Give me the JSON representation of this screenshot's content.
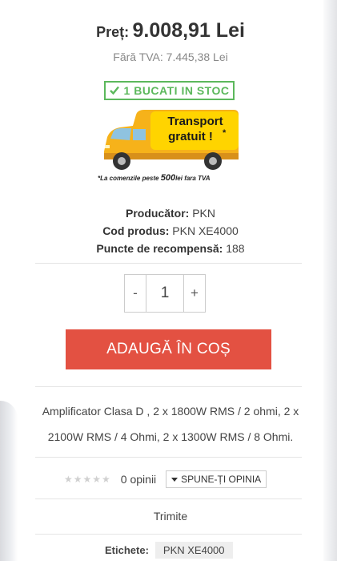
{
  "price": {
    "label": "Preț:",
    "value": "9.008,91 Lei",
    "no_vat": "Fără TVA: 7.445,38 Lei"
  },
  "stock": {
    "text": "1 BUCATI IN STOC",
    "icon": "check-icon",
    "color": "#5cb85c"
  },
  "promo": {
    "banner_line1": "Transport",
    "banner_line2": "gratuit !",
    "banner_asterisk": "*",
    "note_prefix": "*La comenzile peste ",
    "note_amount": "500",
    "note_unit": "lei",
    "note_suffix": " fara TVA"
  },
  "specs": {
    "producer_label": "Producător:",
    "producer_value": "PKN",
    "code_label": "Cod produs:",
    "code_value": "PKN XE4000",
    "points_label": "Puncte de recompensă:",
    "points_value": "188"
  },
  "quantity": {
    "minus": "-",
    "value": "1",
    "plus": "+"
  },
  "cart": {
    "button_label": "ADAUGĂ ÎN COȘ",
    "color": "#e35142"
  },
  "description": "Amplificator Clasa D , 2 x 1800W RMS / 2 ohmi, 2 x 2100W RMS / 4 Ohmi, 2 x 1300W RMS / 8 Ohmi.",
  "reviews": {
    "stars": "★★★★★",
    "rating": 0,
    "count_text": "0 opinii",
    "write_label": "SPUNE-ȚI OPINIA",
    "write_icon": "caret-down-icon"
  },
  "share": {
    "label": "Trimite"
  },
  "tags": {
    "label": "Etichete:",
    "items": [
      "PKN XE4000"
    ]
  }
}
